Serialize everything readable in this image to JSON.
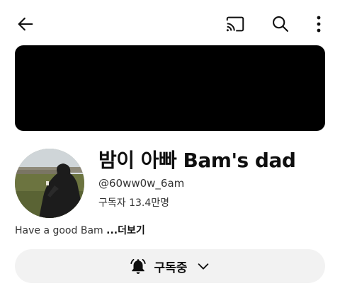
{
  "header": {
    "back_icon": "arrow-left-icon",
    "cast_icon": "cast-icon",
    "search_icon": "search-icon",
    "more_icon": "more-vertical-icon"
  },
  "channel": {
    "name": "밤이 아빠 Bam's dad",
    "handle": "@60ww0w_6am",
    "subscribers": "구독자 13.4만명",
    "description": "Have a good Bam ",
    "more_label": "...더보기"
  },
  "subscribe_button": {
    "label": "구독중",
    "bell_icon": "bell-icon",
    "chevron_icon": "chevron-down-icon"
  },
  "colors": {
    "banner": "#000000",
    "button_bg": "#f2f2f2",
    "text": "#0f0f0f"
  }
}
